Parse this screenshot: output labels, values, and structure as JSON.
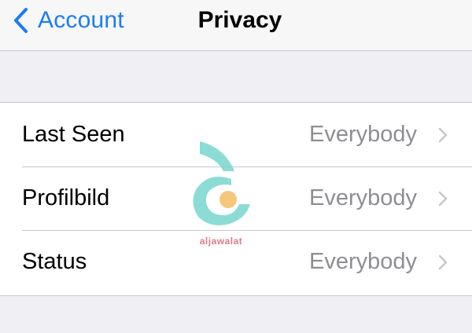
{
  "navbar": {
    "back_label": "Account",
    "title": "Privacy"
  },
  "privacy": {
    "items": [
      {
        "label": "Last Seen",
        "value": "Everybody"
      },
      {
        "label": "Profilbild",
        "value": "Everybody"
      },
      {
        "label": "Status",
        "value": "Everybody"
      }
    ]
  },
  "watermark": {
    "text": "aljawalat",
    "colors": {
      "teal": "#7fd8d2",
      "orange": "#f6c77a",
      "pink": "#e07a86"
    }
  },
  "colors": {
    "accent": "#1a7cf5",
    "background": "#efeff4",
    "secondary_text": "#8e8e93",
    "separator": "#c8c7cc"
  }
}
